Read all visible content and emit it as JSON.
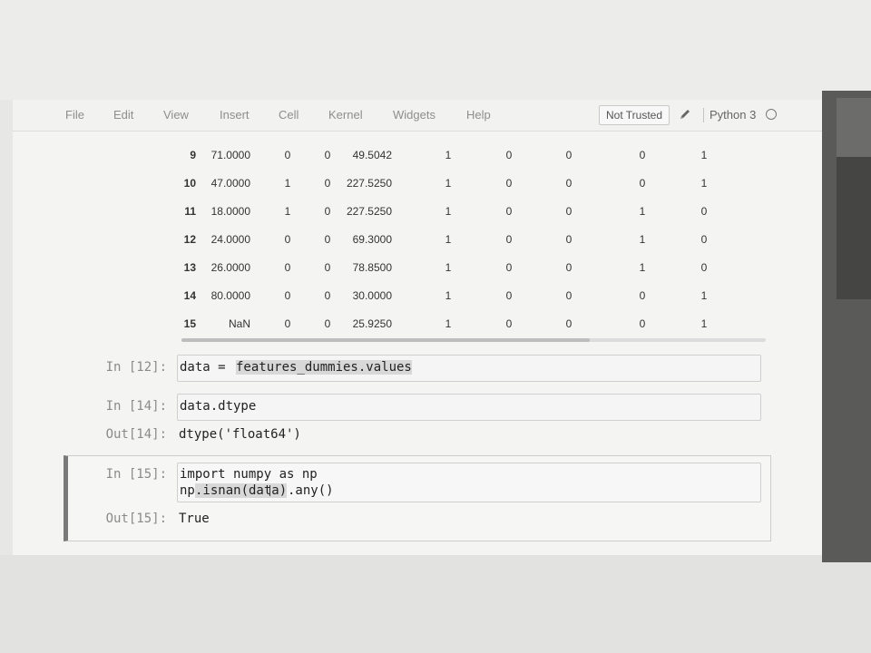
{
  "menu": {
    "items": [
      "File",
      "Edit",
      "View",
      "Insert",
      "Cell",
      "Kernel",
      "Widgets",
      "Help"
    ],
    "trust_label": "Not Trusted",
    "kernel_name": "Python 3"
  },
  "dataframe": {
    "rows": [
      {
        "idx": "9",
        "age": "71.0000",
        "c1": "0",
        "c2": "0",
        "fare": "49.5042",
        "c3": "1",
        "c4": "0",
        "c5": "0",
        "c6": "0",
        "c7": "1"
      },
      {
        "idx": "10",
        "age": "47.0000",
        "c1": "1",
        "c2": "0",
        "fare": "227.5250",
        "c3": "1",
        "c4": "0",
        "c5": "0",
        "c6": "0",
        "c7": "1"
      },
      {
        "idx": "11",
        "age": "18.0000",
        "c1": "1",
        "c2": "0",
        "fare": "227.5250",
        "c3": "1",
        "c4": "0",
        "c5": "0",
        "c6": "1",
        "c7": "0"
      },
      {
        "idx": "12",
        "age": "24.0000",
        "c1": "0",
        "c2": "0",
        "fare": "69.3000",
        "c3": "1",
        "c4": "0",
        "c5": "0",
        "c6": "1",
        "c7": "0"
      },
      {
        "idx": "13",
        "age": "26.0000",
        "c1": "0",
        "c2": "0",
        "fare": "78.8500",
        "c3": "1",
        "c4": "0",
        "c5": "0",
        "c6": "1",
        "c7": "0"
      },
      {
        "idx": "14",
        "age": "80.0000",
        "c1": "0",
        "c2": "0",
        "fare": "30.0000",
        "c3": "1",
        "c4": "0",
        "c5": "0",
        "c6": "0",
        "c7": "1"
      },
      {
        "idx": "15",
        "age": "NaN",
        "c1": "0",
        "c2": "0",
        "fare": "25.9250",
        "c3": "1",
        "c4": "0",
        "c5": "0",
        "c6": "0",
        "c7": "1"
      }
    ]
  },
  "cells": {
    "c12": {
      "prompt": "In [12]:",
      "code_var": "data = ",
      "code_rest": "features_dummies.values"
    },
    "c14": {
      "prompt": "In [14]:",
      "code": "data.dtype",
      "out_prompt": "Out[14]:",
      "output": "dtype('float64')"
    },
    "c15": {
      "prompt": "In [15]:",
      "line1": "import numpy as np",
      "line2_pre": "np",
      "line2_hl": ".isnan(data)",
      "line2_post": ".any()",
      "out_prompt": "Out[15]:",
      "output": "True"
    }
  }
}
